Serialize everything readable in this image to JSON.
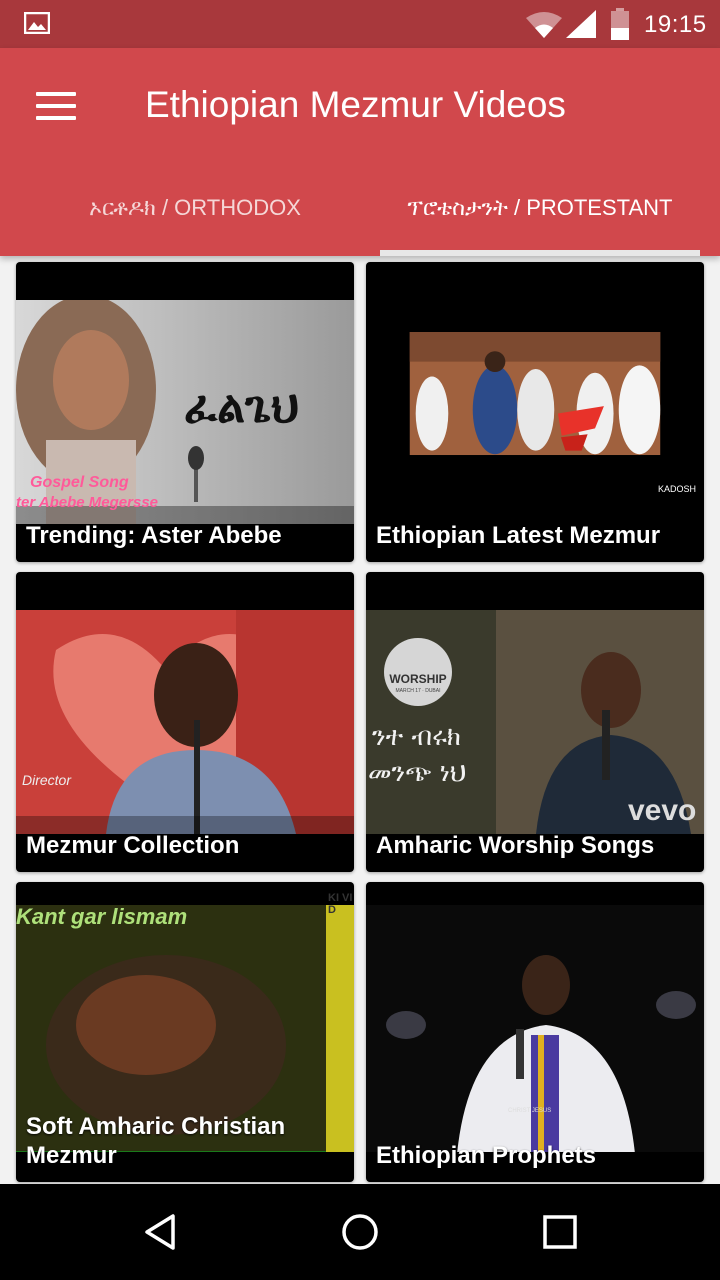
{
  "status_bar": {
    "time": "19:15",
    "icons": [
      "image-notification-icon",
      "wifi-icon",
      "signal-icon",
      "battery-icon"
    ]
  },
  "app_bar": {
    "title": "Ethiopian Mezmur Videos",
    "menu_icon": "hamburger-menu-icon",
    "background_color": "#d1484c"
  },
  "tabs": [
    {
      "label": "ኦርቶዶክ / ORTHODOX",
      "selected": false
    },
    {
      "label": "ፕሮቴስታንት / PROTESTANT",
      "selected": true
    }
  ],
  "cards": [
    {
      "title": "Trending: Aster Abebe",
      "thumb_overlay": {
        "amharic": "ፈልጌህ",
        "caption1": "Gospel Song",
        "caption2": "ter Abebe Megersse"
      }
    },
    {
      "title": "Ethiopian Latest Mezmur",
      "thumb_overlay": {
        "watermark": "KADOSH"
      }
    },
    {
      "title": "Mezmur Collection",
      "thumb_overlay": {
        "watermark": "Director"
      }
    },
    {
      "title": "Amharic Worship Songs",
      "thumb_overlay": {
        "badge": "WORSHIP",
        "badge_sub": "MARCH 17 · DUBAI",
        "line1": "ንተ ብሩክ",
        "line2": "መንጭ ነህ",
        "brand": "vevo"
      }
    },
    {
      "title": "Soft Amharic Christian Mezmur",
      "thumb_overlay": {
        "caption": "Kant gar lismam",
        "watermark": "KI VID"
      }
    },
    {
      "title": "Ethiopian Prophets",
      "thumb_overlay": {
        "shirt_text": "CHRIST JESUS"
      }
    }
  ],
  "nav_bar": {
    "buttons": [
      "back-icon",
      "home-icon",
      "recents-icon"
    ]
  }
}
